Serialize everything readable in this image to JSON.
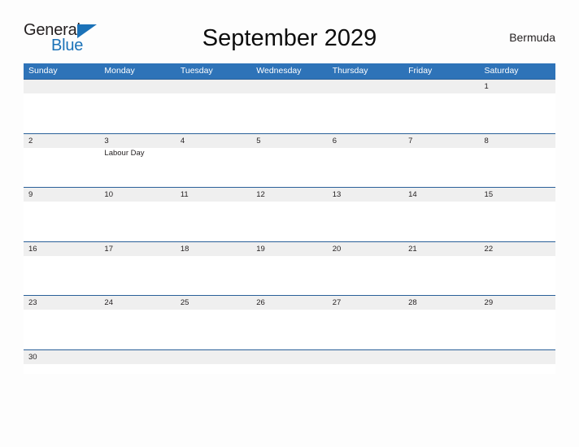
{
  "logo": {
    "word_general": "General",
    "word_blue": "Blue",
    "triangle_color": "#1b72b8"
  },
  "header": {
    "title": "September 2029",
    "region": "Bermuda"
  },
  "colors": {
    "header_blue": "#2e73b8",
    "row_divider_blue": "#2a6099",
    "date_band_gray": "#efefef",
    "page_background": "#fdfdfd",
    "text": "#231f20"
  },
  "calendar": {
    "day_headers": [
      "Sunday",
      "Monday",
      "Tuesday",
      "Wednesday",
      "Thursday",
      "Friday",
      "Saturday"
    ],
    "weeks": [
      {
        "days": [
          {
            "num": "",
            "event": ""
          },
          {
            "num": "",
            "event": ""
          },
          {
            "num": "",
            "event": ""
          },
          {
            "num": "",
            "event": ""
          },
          {
            "num": "",
            "event": ""
          },
          {
            "num": "",
            "event": ""
          },
          {
            "num": "1",
            "event": ""
          }
        ]
      },
      {
        "days": [
          {
            "num": "2",
            "event": ""
          },
          {
            "num": "3",
            "event": "Labour Day"
          },
          {
            "num": "4",
            "event": ""
          },
          {
            "num": "5",
            "event": ""
          },
          {
            "num": "6",
            "event": ""
          },
          {
            "num": "7",
            "event": ""
          },
          {
            "num": "8",
            "event": ""
          }
        ]
      },
      {
        "days": [
          {
            "num": "9",
            "event": ""
          },
          {
            "num": "10",
            "event": ""
          },
          {
            "num": "11",
            "event": ""
          },
          {
            "num": "12",
            "event": ""
          },
          {
            "num": "13",
            "event": ""
          },
          {
            "num": "14",
            "event": ""
          },
          {
            "num": "15",
            "event": ""
          }
        ]
      },
      {
        "days": [
          {
            "num": "16",
            "event": ""
          },
          {
            "num": "17",
            "event": ""
          },
          {
            "num": "18",
            "event": ""
          },
          {
            "num": "19",
            "event": ""
          },
          {
            "num": "20",
            "event": ""
          },
          {
            "num": "21",
            "event": ""
          },
          {
            "num": "22",
            "event": ""
          }
        ]
      },
      {
        "days": [
          {
            "num": "23",
            "event": ""
          },
          {
            "num": "24",
            "event": ""
          },
          {
            "num": "25",
            "event": ""
          },
          {
            "num": "26",
            "event": ""
          },
          {
            "num": "27",
            "event": ""
          },
          {
            "num": "28",
            "event": ""
          },
          {
            "num": "29",
            "event": ""
          }
        ]
      },
      {
        "days": [
          {
            "num": "30",
            "event": ""
          },
          {
            "num": "",
            "event": ""
          },
          {
            "num": "",
            "event": ""
          },
          {
            "num": "",
            "event": ""
          },
          {
            "num": "",
            "event": ""
          },
          {
            "num": "",
            "event": ""
          },
          {
            "num": "",
            "event": ""
          }
        ]
      }
    ]
  }
}
